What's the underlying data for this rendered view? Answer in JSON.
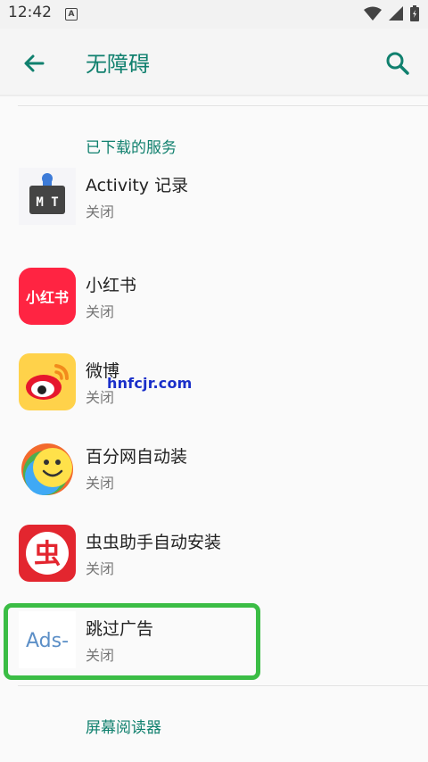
{
  "status_bar": {
    "time": "12:42",
    "notification_letter": "A"
  },
  "app_bar": {
    "title": "无障碍"
  },
  "section_downloaded": {
    "header": "已下载的服务"
  },
  "services": [
    {
      "name": "Activity 记录",
      "status": "关闭",
      "icon": "activity-record-icon",
      "icon_text": "M T"
    },
    {
      "name": "小红书",
      "status": "关闭",
      "icon": "xiaohongshu-icon",
      "icon_text": "小红书"
    },
    {
      "name": "微博",
      "status": "关闭",
      "icon": "weibo-icon"
    },
    {
      "name": "百分网自动装",
      "status": "关闭",
      "icon": "baifen-icon"
    },
    {
      "name": "虫虫助手自动安装",
      "status": "关闭",
      "icon": "chongchong-icon",
      "icon_text": "虫"
    },
    {
      "name": "跳过广告",
      "status": "关闭",
      "icon": "ads-skip-icon",
      "icon_text": "Ads-"
    }
  ],
  "section_screen_reader": {
    "header": "屏幕阅读器"
  },
  "watermark": "hnfcjr.com",
  "colors": {
    "accent": "#10806e",
    "highlight": "#3bbd45",
    "xiaohongshu": "#ff2442",
    "chongchong": "#e3262f"
  }
}
